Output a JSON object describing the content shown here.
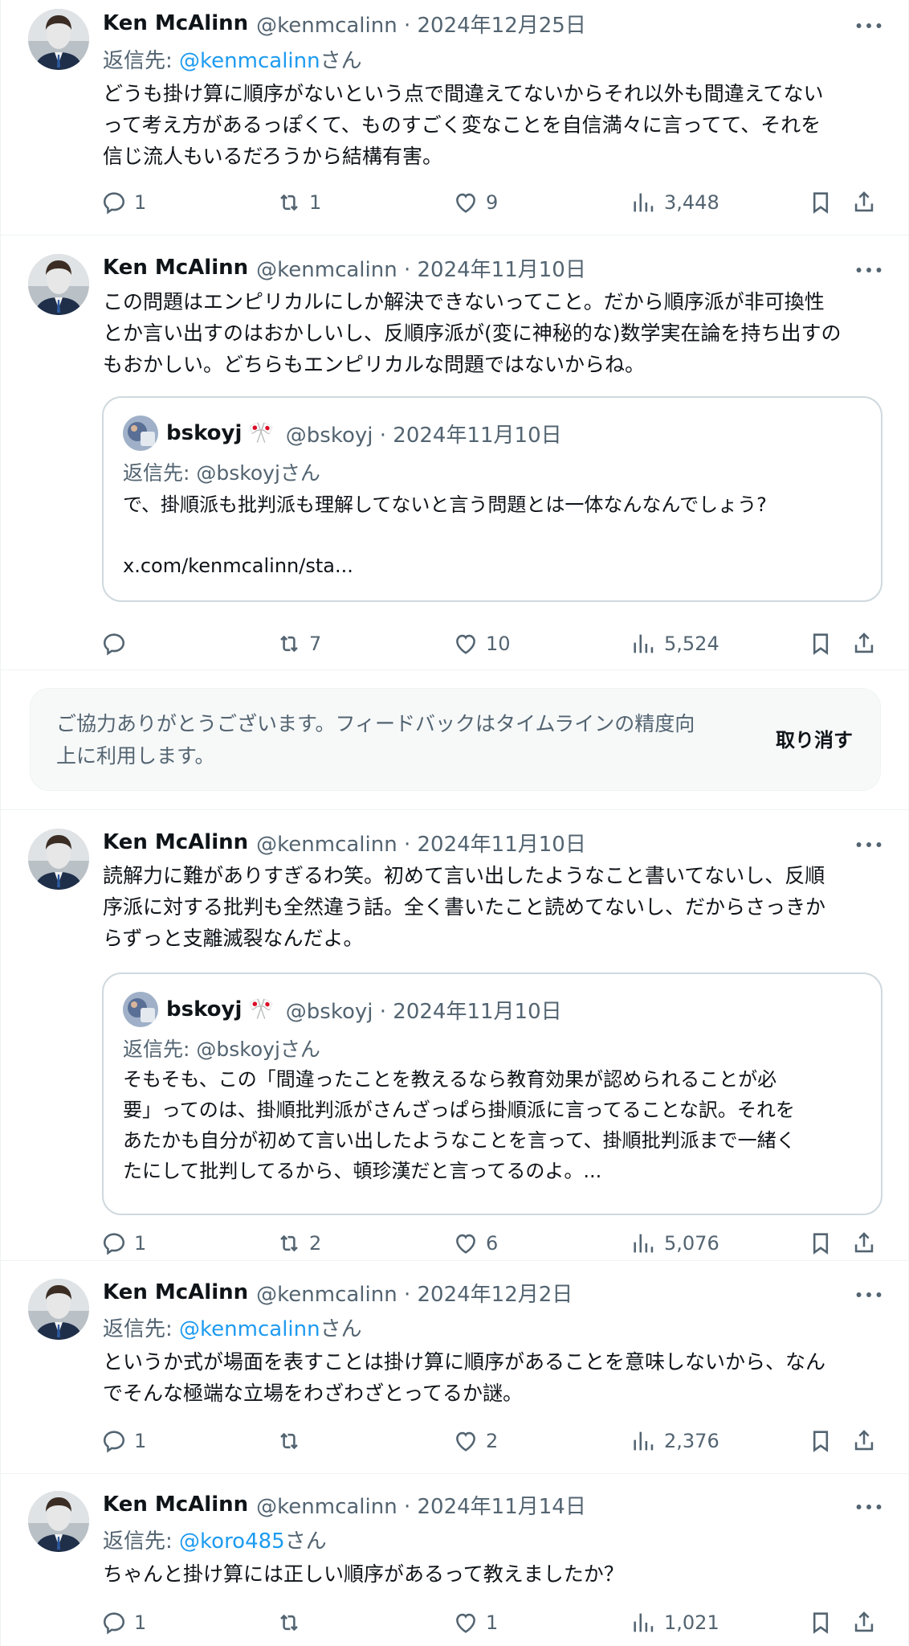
{
  "colors": {
    "accent": "#1d9bf0",
    "muted": "#536471",
    "text": "#0f1419",
    "border": "#cfd9de"
  },
  "icons": {
    "reply": "reply-icon",
    "retweet": "retweet-icon",
    "like": "heart-icon",
    "views": "views-icon",
    "bookmark": "bookmark-icon",
    "share": "share-icon",
    "more": "more-icon"
  },
  "posts": [
    {
      "name": "Ken McAlinn",
      "meta": "@kenmcalinn · 2024年12月25日",
      "reply_prefix": "返信先: ",
      "reply_handle": "@kenmcalinn",
      "reply_suffix": "さん",
      "text": "どうも掛け算に順序がないという点で間違えてないからそれ以外も間違えてない\nって考え方があるっぽくて、ものすごく変なことを自信満々に言ってて、それを\n信じ流人もいるだろうから結構有害。",
      "reply_count": "1",
      "retweet_count": "1",
      "like_count": "9",
      "views": "3,448"
    },
    {
      "name": "Ken McAlinn",
      "meta": "@kenmcalinn · 2024年11月10日",
      "text": "この問題はエンピリカルにしか解決できないってこと。だから順序派が非可換性\nとか言い出すのはおかしいし、反順序派が(変に神秘的な)数学実在論を持ち出すの\nもおかしい。どちらもエンピリカルな問題ではないからね。",
      "quote": {
        "name": "bskoyj",
        "badge": "🎌",
        "meta": "@bskoyj · 2024年11月10日",
        "reply": "返信先: @bskoyjさん",
        "text": "で、掛順派も批判派も理解してないと言う問題とは一体なんなんでしょう?\n\nx.com/kenmcalinn/sta..."
      },
      "reply_count": "",
      "retweet_count": "7",
      "like_count": "10",
      "views": "5,524"
    },
    {
      "name": "Ken McAlinn",
      "meta": "@kenmcalinn · 2024年11月10日",
      "text": "読解力に難がありすぎるわ笑。初めて言い出したようなこと書いてないし、反順\n序派に対する批判も全然違う話。全く書いたこと読めてないし、だからさっきか\nらずっと支離滅裂なんだよ。",
      "quote": {
        "name": "bskoyj",
        "badge": "🎌",
        "meta": "@bskoyj · 2024年11月10日",
        "reply": "返信先: @bskoyjさん",
        "text": "そもそも、この「間違ったことを教えるなら教育効果が認められることが必\n要」ってのは、掛順批判派がさんざっぱら掛順派に言ってることな訳。それを\nあたかも自分が初めて言い出したようなことを言って、掛順批判派まで一緒く\nたにして批判してるから、頓珍漢だと言ってるのよ。..."
      },
      "reply_count": "1",
      "retweet_count": "2",
      "like_count": "6",
      "views": "5,076"
    },
    {
      "name": "Ken McAlinn",
      "meta": "@kenmcalinn · 2024年12月2日",
      "reply_prefix": "返信先: ",
      "reply_handle": "@kenmcalinn",
      "reply_suffix": "さん",
      "text": "というか式が場面を表すことは掛け算に順序があることを意味しないから、なん\nでそんな極端な立場をわざわざとってるか謎。",
      "reply_count": "1",
      "retweet_count": "",
      "like_count": "2",
      "views": "2,376"
    },
    {
      "name": "Ken McAlinn",
      "meta": "@kenmcalinn · 2024年11月14日",
      "reply_prefix": "返信先: ",
      "reply_handle": "@koro485",
      "reply_suffix": "さん",
      "text": "ちゃんと掛け算には正しい順序があるって教えましたか？",
      "reply_count": "1",
      "retweet_count": "",
      "like_count": "1",
      "views": "1,021"
    }
  ],
  "notice": {
    "text": "ご協力ありがとうございます。フィードバックはタイムラインの精度向\n上に利用します。",
    "undo": "取り消す"
  }
}
